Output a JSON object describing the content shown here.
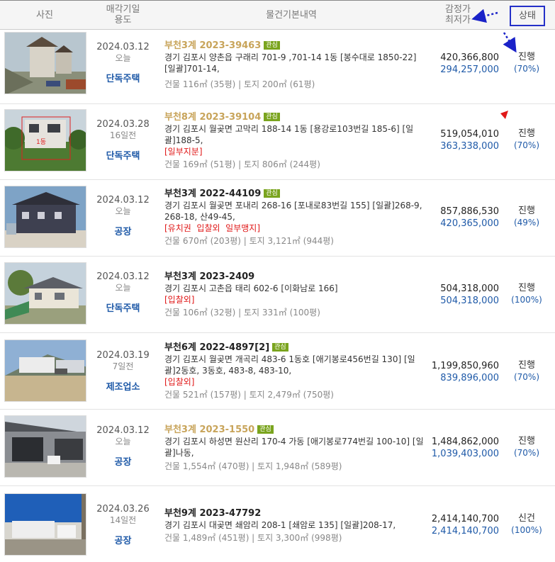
{
  "header": {
    "photo": "사진",
    "date_line1": "매각기일",
    "date_line2": "용도",
    "info": "물건기본내역",
    "price_line1": "감정가",
    "price_line2": "최저가",
    "status": "상태"
  },
  "rows": [
    {
      "date": "2024.03.12",
      "rel": "오늘",
      "use": "단독주택",
      "case": "부천3계 2023-39463",
      "case_gold": true,
      "badge": "관심",
      "addr": "경기 김포시 양촌읍 구래리 701-9 ,701-14 1동 [봉수대로 1850-22] [일괄]701-14,",
      "warn": "",
      "area": "건물 116㎡ (35평)  |  토지 200㎡ (61평)",
      "appraisal": "420,366,800",
      "minprice": "294,257,000",
      "status": "진행",
      "pct": "(70%)"
    },
    {
      "date": "2024.03.28",
      "rel": "16일전",
      "use": "단독주택",
      "case": "부천8계 2023-39104",
      "case_gold": true,
      "badge": "관심",
      "addr": "경기 김포시 월곶면 고막리 188-14 1동 [용강로103번길 185-6] [일괄]188-5,",
      "warn": "[일부지분]",
      "area": "건물 169㎡ (51평)  |  토지 806㎡ (244평)",
      "appraisal": "519,054,010",
      "minprice": "363,338,000",
      "status": "진행",
      "pct": "(70%)"
    },
    {
      "date": "2024.03.12",
      "rel": "오늘",
      "use": "공장",
      "case": "부천3계 2022-44109",
      "case_gold": false,
      "badge": "관심",
      "addr": "경기 김포시 월곶면 포내리 268-16 [포내로83번길 155] [일괄]268-9, 268-18, 산49-45,",
      "warn": "[유치권  입찰외  일부맹지]",
      "area": "건물 670㎡ (203평)  |  토지 3,121㎡ (944평)",
      "appraisal": "857,886,530",
      "minprice": "420,365,000",
      "status": "진행",
      "pct": "(49%)"
    },
    {
      "date": "2024.03.12",
      "rel": "오늘",
      "use": "단독주택",
      "case": "부천3계 2023-2409",
      "case_gold": false,
      "badge": "",
      "addr": "경기 김포시 고촌읍 태리 602-6 [이화남로 166]",
      "warn": "[입찰외]",
      "area": "건물 106㎡ (32평)  |  토지 331㎡ (100평)",
      "appraisal": "504,318,000",
      "minprice": "504,318,000",
      "status": "진행",
      "pct": "(100%)"
    },
    {
      "date": "2024.03.19",
      "rel": "7일전",
      "use": "제조업소",
      "case": "부천6계 2022-4897[2]",
      "case_gold": false,
      "badge": "관심",
      "addr": "경기 김포시 월곶면 개곡리 483-6 1동호 [애기봉로456번길 130] [일괄]2동호, 3동호, 483-8, 483-10,",
      "warn": "[입찰외]",
      "area": "건물 521㎡ (157평)  |  토지 2,479㎡ (750평)",
      "appraisal": "1,199,850,960",
      "minprice": "839,896,000",
      "status": "진행",
      "pct": "(70%)"
    },
    {
      "date": "2024.03.12",
      "rel": "오늘",
      "use": "공장",
      "case": "부천3계 2023-1550",
      "case_gold": true,
      "badge": "관심",
      "addr": "경기 김포시 하성면 원산리 170-4 가동 [애기봉로774번길 100-10] [일괄]나동,",
      "warn": "",
      "area": "건물 1,554㎡ (470평)  |  토지 1,948㎡ (589평)",
      "appraisal": "1,484,862,000",
      "minprice": "1,039,403,000",
      "status": "진행",
      "pct": "(70%)"
    },
    {
      "date": "2024.03.26",
      "rel": "14일전",
      "use": "공장",
      "case": "부천9계 2023-47792",
      "case_gold": false,
      "badge": "",
      "addr": "경기 김포시 대곶면 쇄암리 208-1 [쇄암로 135] [일괄]208-17,",
      "warn": "",
      "area": "건물 1,489㎡ (451평)  |  토지 3,300㎡ (998평)",
      "appraisal": "2,414,140,700",
      "minprice": "2,414,140,700",
      "status": "신건",
      "pct": "(100%)"
    }
  ]
}
